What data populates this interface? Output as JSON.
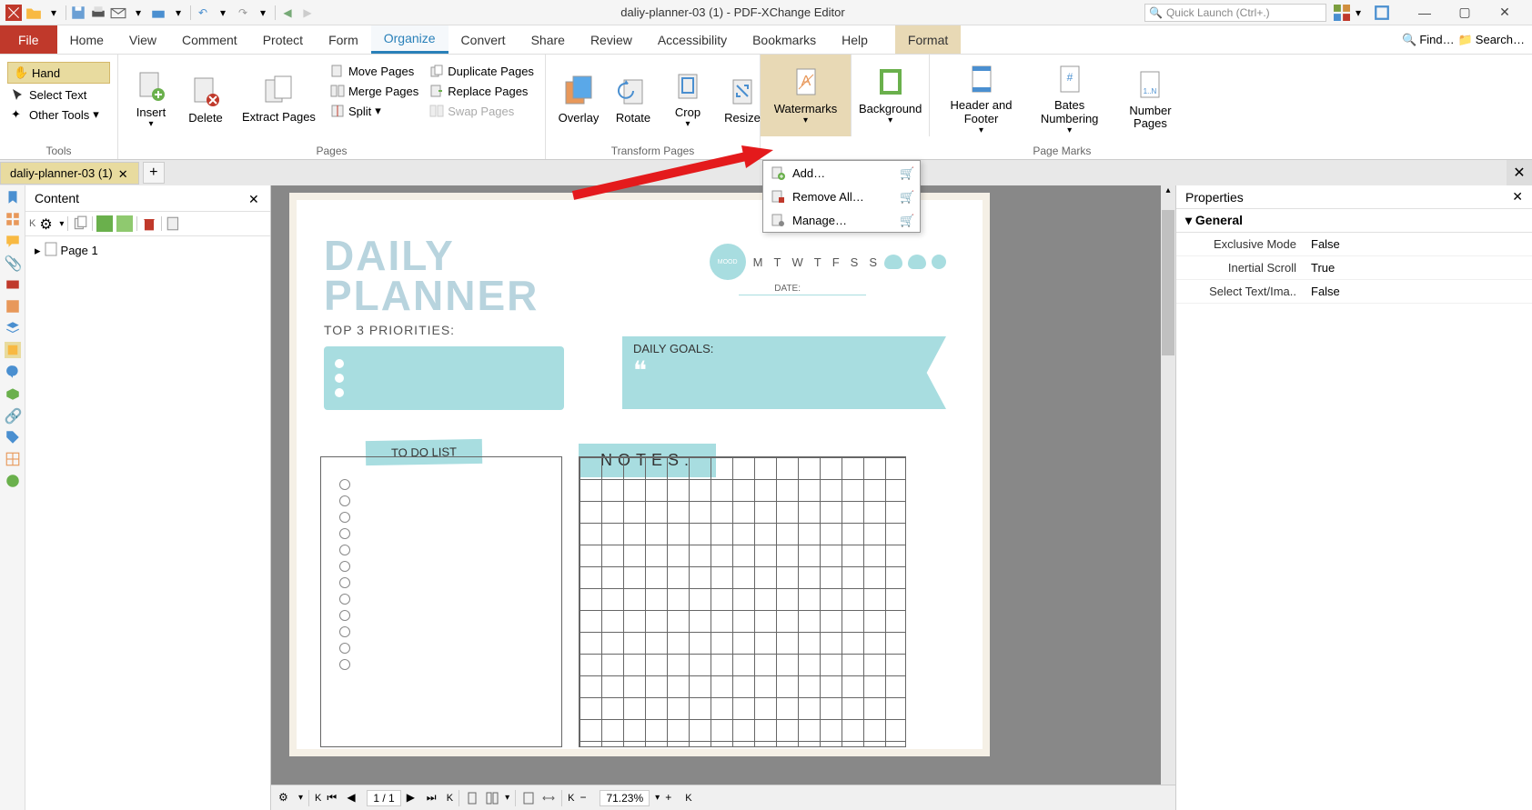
{
  "titlebar": {
    "title": "daliy-planner-03 (1) - PDF-XChange Editor",
    "quick_launch_placeholder": "Quick Launch (Ctrl+.)"
  },
  "menubar": {
    "file": "File",
    "items": [
      "Home",
      "View",
      "Comment",
      "Protect",
      "Form",
      "Organize",
      "Convert",
      "Share",
      "Review",
      "Accessibility",
      "Bookmarks",
      "Help"
    ],
    "format": "Format",
    "find": "Find…",
    "search": "Search…"
  },
  "ribbon": {
    "tools": {
      "hand": "Hand",
      "select_text": "Select Text",
      "other": "Other Tools",
      "label": "Tools"
    },
    "pages": {
      "insert": "Insert",
      "delete": "Delete",
      "extract": "Extract Pages",
      "move": "Move Pages",
      "merge": "Merge Pages",
      "split": "Split",
      "duplicate": "Duplicate Pages",
      "replace": "Replace Pages",
      "swap": "Swap Pages",
      "label": "Pages"
    },
    "transform": {
      "overlay": "Overlay",
      "rotate": "Rotate",
      "crop": "Crop",
      "resize": "Resize",
      "label": "Transform Pages"
    },
    "watermarks": "Watermarks",
    "background": "Background",
    "header_footer": "Header and Footer",
    "bates": "Bates Numbering",
    "number": "Number Pages",
    "page_marks_label": "Page Marks"
  },
  "dropdown": {
    "add": "Add…",
    "remove": "Remove All…",
    "manage": "Manage…"
  },
  "doc_tab": {
    "name": "daliy-planner-03 (1)"
  },
  "content_pane": {
    "title": "Content",
    "page1": "Page 1"
  },
  "properties": {
    "title": "Properties",
    "general": "General",
    "rows": [
      {
        "label": "Exclusive Mode",
        "value": "False"
      },
      {
        "label": "Inertial Scroll",
        "value": "True"
      },
      {
        "label": "Select Text/Ima..",
        "value": "False"
      }
    ]
  },
  "statusbar": {
    "page": "1 / 1",
    "zoom": "71.23%"
  },
  "planner": {
    "title1": "DAILY",
    "title2": "PLANNER",
    "priorities_label": "TOP 3 PRIORITIES:",
    "days": [
      "M",
      "T",
      "W",
      "T",
      "F",
      "S",
      "S"
    ],
    "mood": "MOOD",
    "date_label": "DATE:",
    "goals_label": "DAILY GOALS:",
    "todo_label": "TO DO LIST",
    "notes_label": "NOTES:"
  }
}
